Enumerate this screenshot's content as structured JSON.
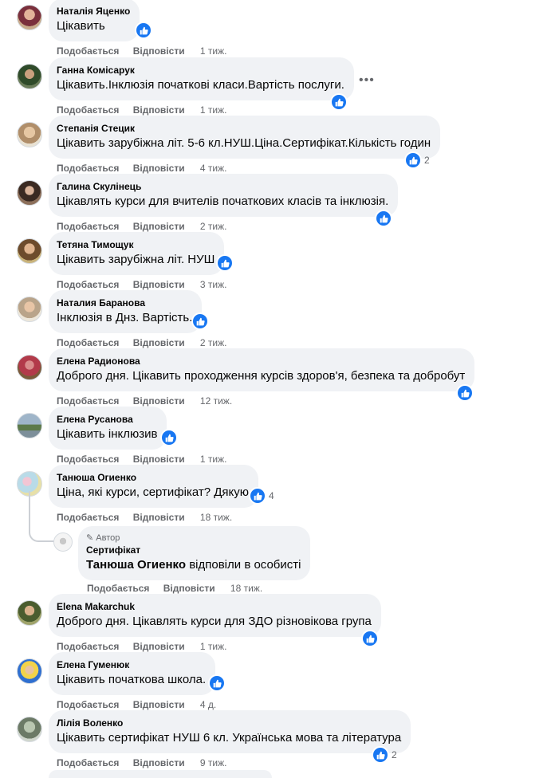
{
  "actions": {
    "like": "Подобається",
    "reply": "Відповісти"
  },
  "comments": [
    {
      "author": "Наталія Яценко",
      "text": "Цікавить",
      "time": "1 тиж.",
      "reactions": ""
    },
    {
      "author": "Ганна Комісарук",
      "text": "Цікавить.Інклюзія початкові класи.Вартість послуги.",
      "time": "1 тиж.",
      "reactions": ""
    },
    {
      "author": "Степанія Стецик",
      "text": "Цікавить зарубіжна літ. 5-6 кл.НУШ.Ціна.Сертифікат.Кількість годин",
      "time": "4 тиж.",
      "reactions": "2"
    },
    {
      "author": "Галина Скулінець",
      "text": "Цікавлять курси для вчителів початкових класів та інклюзія.",
      "time": "2 тиж.",
      "reactions": ""
    },
    {
      "author": "Тетяна Тимощук",
      "text": "Цікавить зарубіжна літ. НУШ",
      "time": "3 тиж.",
      "reactions": ""
    },
    {
      "author": "Наталия Баранова",
      "text": "Інклюзія в Днз. Вартість.",
      "time": "2 тиж.",
      "reactions": ""
    },
    {
      "author": "Елена Радионова",
      "text": "Доброго дня. Цікавить проходження курсів здоров'я, безпека та добробут",
      "time": "12 тиж.",
      "reactions": ""
    },
    {
      "author": "Елена Русанова",
      "text": "Цікавить інклюзив",
      "time": "1 тиж.",
      "reactions": ""
    },
    {
      "author": "Танюша Огиенко",
      "text": "Ціна, які курси, сертифікат? Дякую",
      "time": "18 тиж.",
      "reactions": "4"
    },
    {
      "author": "Elena Makarchuk",
      "text": "Доброго дня. Цікавлять курси для ЗДО різновікова група",
      "time": "1 тиж.",
      "reactions": ""
    },
    {
      "author": "Елена Гуменюк",
      "text": "Цікавить початкова школа.",
      "time": "4 д.",
      "reactions": ""
    },
    {
      "author": "Лілія Воленко",
      "text": "Цікавить сертифікат НУШ 6 кл. Українська мова та література",
      "time": "9 тиж.",
      "reactions": "2"
    }
  ],
  "reply": {
    "badge": "Автор",
    "author": "Сертифікат",
    "mention": "Танюша Огиенко",
    "text": " відповіли в особисті",
    "time": "18 тиж."
  },
  "colors": {
    "like": "#1877f2",
    "bubble": "#f0f2f5",
    "meta": "#65676b"
  },
  "icons": {
    "like": "thumbs-up-icon",
    "more": "more-options-icon",
    "author_badge": "pencil-icon"
  }
}
